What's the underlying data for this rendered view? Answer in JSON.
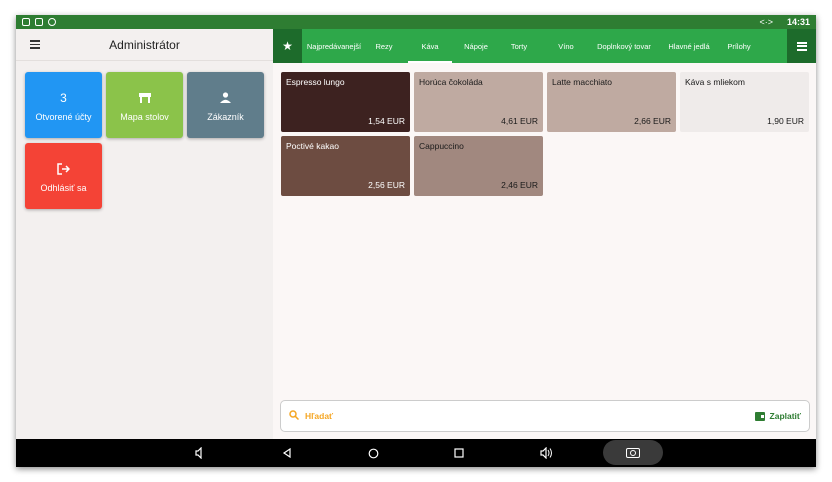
{
  "status": {
    "network": "<·>",
    "time": "14:31"
  },
  "left": {
    "title": "Administrátor",
    "tiles": [
      {
        "icon_name": "count-3",
        "icon_text": "3",
        "label": "Otvorené účty",
        "color": "#2196f3"
      },
      {
        "icon_name": "table-icon",
        "icon_text": "▀▀",
        "label": "Mapa stolov",
        "color": "#8bc34a"
      },
      {
        "icon_name": "person-icon",
        "icon_text": "●",
        "label": "Zákazník",
        "color": "#607d8b"
      },
      {
        "icon_name": "logout-icon",
        "icon_text": "⇥",
        "label": "Odhlásiť sa",
        "color": "#f44336"
      }
    ]
  },
  "categories": {
    "tabs": [
      {
        "label": "Najpredávanejší",
        "active": false
      },
      {
        "label": "Rezy",
        "active": false
      },
      {
        "label": "Káva",
        "active": true
      },
      {
        "label": "Nápoje",
        "active": false
      },
      {
        "label": "Torty",
        "active": false
      },
      {
        "label": "Víno",
        "active": false
      },
      {
        "label": "Doplnkový tovar",
        "active": false
      },
      {
        "label": "Hlavné jedlá",
        "active": false
      },
      {
        "label": "Prílohy",
        "active": false
      }
    ]
  },
  "products": [
    {
      "name": "Espresso lungo",
      "price": "1,54 EUR",
      "color": "#3d2220",
      "text": "#ffffff"
    },
    {
      "name": "Horúca čokoláda",
      "price": "4,61 EUR",
      "color": "#bfaaa1",
      "text": "#1a1a1a"
    },
    {
      "name": "Latte macchiato",
      "price": "2,66 EUR",
      "color": "#bfaaa1",
      "text": "#1a1a1a"
    },
    {
      "name": "Káva s mliekom",
      "price": "1,90 EUR",
      "color": "#efebea",
      "text": "#1a1a1a"
    },
    {
      "name": "Poctivé kakao",
      "price": "2,56 EUR",
      "color": "#6d4c41",
      "text": "#ffffff"
    },
    {
      "name": "Cappuccino",
      "price": "2,46 EUR",
      "color": "#a1887f",
      "text": "#1a1a1a"
    }
  ],
  "search": {
    "label": "Hľadať"
  },
  "pay": {
    "label": "Zaplatiť"
  }
}
